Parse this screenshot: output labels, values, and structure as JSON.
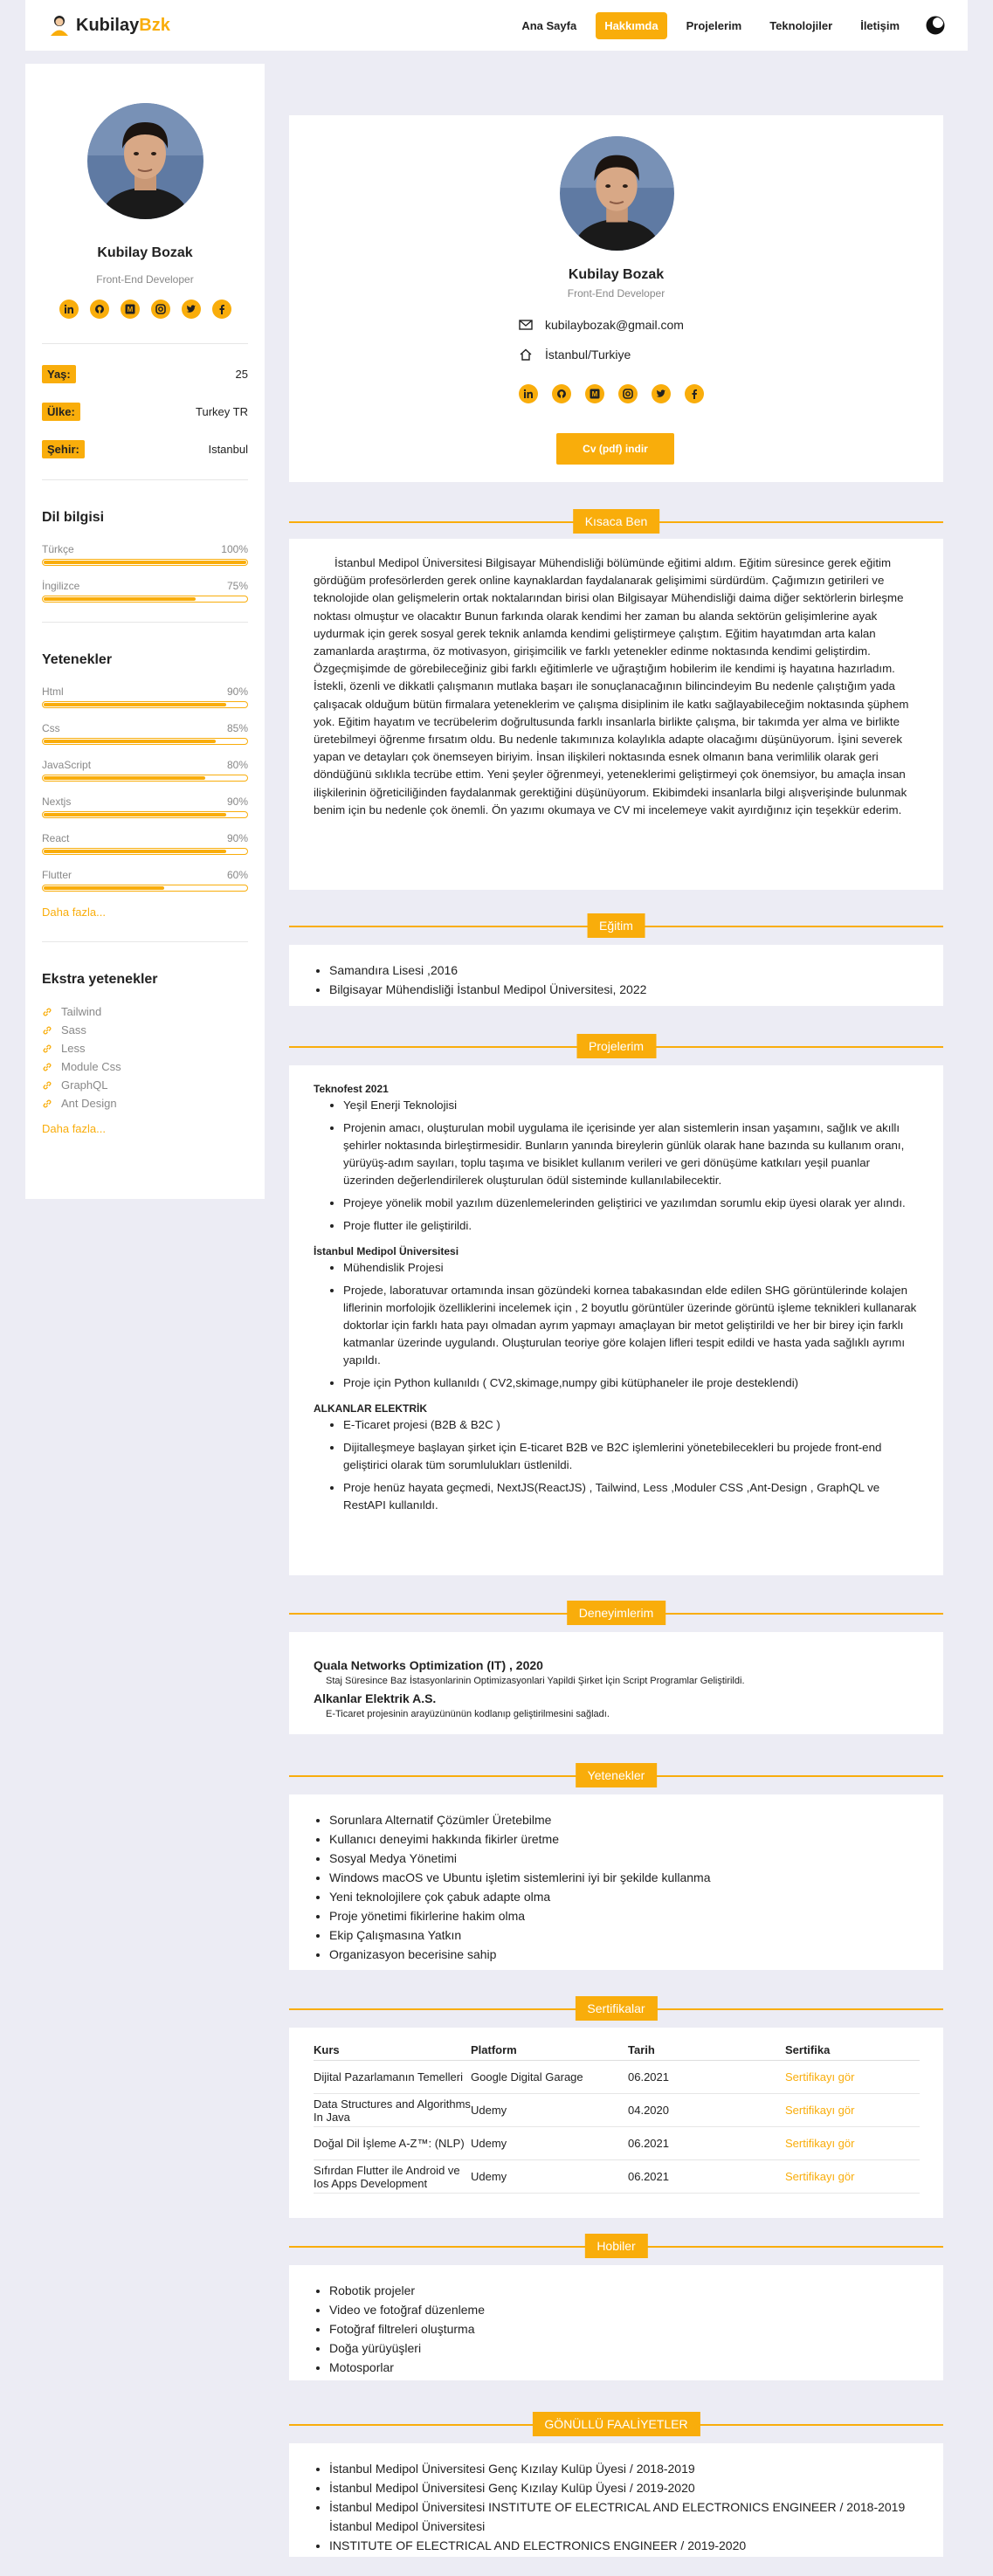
{
  "colors": {
    "accent": "#f9ad0b",
    "page_bg": "#ececf4"
  },
  "nav": {
    "brand_main": "Kubilay",
    "brand_accent": "Bzk",
    "links": [
      "Ana Sayfa",
      "Hakkımda",
      "Projelerim",
      "Teknolojiler",
      "İletişim"
    ],
    "active": "Hakkımda",
    "theme_icon": "moon-icon"
  },
  "sidebar": {
    "name": "Kubilay Bozak",
    "role": "Front-End Developer",
    "social_icons": [
      "linkedin-icon",
      "github-icon",
      "medium-icon",
      "instagram-icon",
      "twitter-icon",
      "facebook-icon"
    ],
    "info": [
      {
        "label": "Yaş:",
        "value": "25"
      },
      {
        "label": "Ülke:",
        "value": "Turkey TR"
      },
      {
        "label": "Şehir:",
        "value": "Istanbul"
      }
    ],
    "languages_title": "Dil bilgisi",
    "languages": [
      {
        "name": "Türkçe",
        "pct": "100%",
        "level": 100
      },
      {
        "name": "İngilizce",
        "pct": "75%",
        "level": 75
      }
    ],
    "skills_title": "Yetenekler",
    "skills": [
      {
        "name": "Html",
        "pct": "90%",
        "level": 90
      },
      {
        "name": "Css",
        "pct": "85%",
        "level": 85
      },
      {
        "name": "JavaScript",
        "pct": "80%",
        "level": 80
      },
      {
        "name": "Nextjs",
        "pct": "90%",
        "level": 90
      },
      {
        "name": "React",
        "pct": "90%",
        "level": 90
      },
      {
        "name": "Flutter",
        "pct": "60%",
        "level": 60
      }
    ],
    "more_label": "Daha fazla...",
    "extra_title": "Ekstra yetenekler",
    "extras": [
      "Tailwind",
      "Sass",
      "Less",
      "Module Css",
      "GraphQL",
      "Ant Design"
    ],
    "more_label2": "Daha fazla..."
  },
  "profile": {
    "name": "Kubilay Bozak",
    "role": "Front-End Developer",
    "email": "kubilaybozak@gmail.com",
    "location": "İstanbul/Turkiye",
    "cv_button": "Cv (pdf) indir"
  },
  "about": {
    "title": "Kısaca Ben",
    "text": "İstanbul Medipol Üniversitesi Bilgisayar Mühendisliği bölümünde eğitimi aldım. Eğitim süresince gerek eğitim gördüğüm profesörlerden gerek online kaynaklardan faydalanarak gelişimimi sürdürdüm. Çağımızın getirileri ve teknolojide olan gelişmelerin ortak noktalarından birisi olan Bilgisayar Mühendisliği daima diğer sektörlerin birleşme noktası olmuştur ve olacaktır Bunun farkında olarak kendimi her zaman bu alanda sektörün gelişimlerine ayak uydurmak için gerek sosyal gerek teknik anlamda kendimi geliştirmeye çalıştım. Eğitim hayatımdan arta kalan zamanlarda araştırma, öz motivasyon, girişimcilik ve farklı yetenekler edinme noktasında kendimi geliştirdim. Özgeçmişimde de görebileceğiniz gibi farklı eğitimlerle ve uğraştığım hobilerim ile kendimi iş hayatına hazırladım. İstekli, özenli ve dikkatli çalışmanın mutlaka başarı ile sonuçlanacağının bilincindeyim Bu nedenle çalıştığım yada çalışacak olduğum bütün firmalara yeteneklerim ve çalışma disiplinim ile katkı sağlayabileceğim noktasında şüphem yok. Eğitim hayatım ve tecrübelerim doğrultusunda farklı insanlarla birlikte çalışma, bir takımda yer alma ve birlikte üretebilmeyi öğrenme fırsatım oldu. Bu nedenle takımınıza kolaylıkla adapte olacağımı düşünüyorum. İşini severek yapan ve detayları çok önemseyen biriyim. İnsan ilişkileri noktasında esnek olmanın bana verimlilik olarak geri döndüğünü sıklıkla tecrübe ettim. Yeni şeyler öğrenmeyi, yeteneklerimi geliştirmeyi çok önemsiyor, bu amaçla insan ilişkilerinin öğreticiliğinden faydalanmak gerektiğini düşünüyorum. Ekibimdeki insanlarla bilgi alışverişinde bulunmak benim için bu nedenle çok önemli. Ön yazımı okumaya ve CV mi incelemeye vakit ayırdığınız için teşekkür ederim."
  },
  "education": {
    "title": "Eğitim",
    "items": [
      "Samandıra Lisesi ,2016",
      "Bilgisayar Mühendisliği İstanbul Medipol Üniversitesi, 2022"
    ]
  },
  "projects": {
    "title": "Projelerim",
    "groups": [
      {
        "head": "Teknofest 2021",
        "items": [
          "Yeşil Enerji Teknolojisi",
          "Projenin amacı, oluşturulan mobil uygulama ile içerisinde yer alan sistemlerin insan yaşamını, sağlık ve akıllı şehirler noktasında birleştirmesidir. Bunların yanında bireylerin günlük olarak hane bazında su kullanım oranı, yürüyüş-adım sayıları, toplu taşıma ve bisiklet kullanım verileri ve geri dönüşüme katkıları yeşil puanlar üzerinden değerlendirilerek oluşturulan ödül sisteminde kullanılabilecektir.",
          "Projeye yönelik mobil yazılım düzenlemelerinden geliştirici ve yazılımdan sorumlu ekip üyesi olarak yer alındı.",
          "Proje flutter ile geliştirildi."
        ]
      },
      {
        "head": "İstanbul Medipol Üniversitesi",
        "items": [
          "Mühendislik Projesi",
          "Projede, laboratuvar ortamında insan gözündeki kornea tabakasından elde edilen SHG görüntülerinde kolajen liflerinin morfolojik özelliklerini incelemek için , 2 boyutlu görüntüler üzerinde görüntü işleme teknikleri kullanarak doktorlar için farklı hata payı olmadan ayrım yapmayı amaçlayan bir metot geliştirildi ve her bir birey için farklı katmanlar üzerinde uygulandı. Oluşturulan teoriye göre kolajen lifleri tespit edildi ve hasta yada sağlıklı ayrımı yapıldı.",
          "Proje için Python kullanıldı ( CV2,skimage,numpy gibi kütüphaneler ile proje desteklendi)"
        ]
      },
      {
        "head": "ALKANLAR ELEKTRİK",
        "items": [
          "E-Ticaret projesi (B2B & B2C )",
          "Dijitalleşmeye başlayan şirket için E-ticaret B2B ve B2C işlemlerini yönetebilecekleri bu projede front-end geliştirici olarak tüm sorumlulukları üstlenildi.",
          "Proje henüz hayata geçmedi, NextJS(ReactJS) , Tailwind, Less ,Moduler CSS ,Ant-Design , GraphQL ve RestAPI kullanıldı."
        ]
      }
    ]
  },
  "experience": {
    "title": "Deneyimlerim",
    "items": [
      {
        "company": "Quala Networks Optimization (IT) , 2020",
        "desc": "Staj Süresince Baz İstasyonlarinin Optimizasyonlari Yapildi Şirket İçin Script Programlar Geliştirildi."
      },
      {
        "company": "Alkanlar Elektrik A.S.",
        "desc": "E-Ticaret projesinin arayüzününün kodlanıp geliştirilmesini sağladı."
      }
    ]
  },
  "abilities": {
    "title": "Yetenekler",
    "items": [
      "Sorunlara Alternatif Çözümler Üretebilme",
      "Kullanıcı deneyimi hakkında fikirler üretme",
      "Sosyal Medya Yönetimi",
      "Windows macOS ve Ubuntu işletim sistemlerini iyi bir şekilde kullanma",
      "Yeni teknolojilere çok çabuk adapte olma",
      "Proje yönetimi fikirlerine hakim olma",
      "Ekip Çalışmasına Yatkın",
      "Organizasyon becerisine sahip"
    ]
  },
  "certificates": {
    "title": "Sertifikalar",
    "headers": [
      "Kurs",
      "Platform",
      "Tarih",
      "Sertifika"
    ],
    "rows": [
      {
        "course": "Dijital Pazarlamanın Temelleri",
        "platform": "Google Digital Garage",
        "date": "06.2021",
        "link": "Sertifikayı gör"
      },
      {
        "course": "Data Structures and Algorithms In Java",
        "platform": "Udemy",
        "date": "04.2020",
        "link": "Sertifikayı gör"
      },
      {
        "course": "Doğal Dil İşleme A-Z™: (NLP)",
        "platform": "Udemy",
        "date": "06.2021",
        "link": "Sertifikayı gör"
      },
      {
        "course": "Sıfırdan Flutter ile Android ve Ios Apps Development",
        "platform": "Udemy",
        "date": "06.2021",
        "link": "Sertifikayı gör"
      }
    ]
  },
  "hobbies": {
    "title": "Hobiler",
    "items": [
      "Robotik projeler",
      "Video ve fotoğraf düzenleme",
      "Fotoğraf filtreleri oluşturma",
      "Doğa yürüyüşleri",
      "Motosporlar"
    ]
  },
  "volunteer": {
    "title": "GÖNÜLLÜ FAALİYETLER",
    "items": [
      "İstanbul Medipol Üniversitesi Genç Kızılay Kulüp Üyesi / 2018-2019",
      "İstanbul Medipol Üniversitesi Genç Kızılay Kulüp Üyesi / 2019-2020",
      "İstanbul Medipol Üniversitesi INSTITUTE OF ELECTRICAL AND ELECTRONICS ENGINEER / 2018-2019 İstanbul Medipol Üniversitesi",
      "INSTITUTE OF ELECTRICAL AND ELECTRONICS ENGINEER / 2019-2020"
    ]
  }
}
